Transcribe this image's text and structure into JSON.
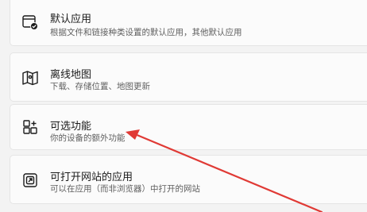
{
  "items": [
    {
      "title": "默认应用",
      "subtitle": "根据文件和链接种类设置的默认应用，其他默认应用",
      "icon": "default-apps-icon"
    },
    {
      "title": "离线地图",
      "subtitle": "下载、存储位置、地图更新",
      "icon": "map-icon"
    },
    {
      "title": "可选功能",
      "subtitle": "你的设备的额外功能",
      "icon": "optional-features-icon"
    },
    {
      "title": "可打开网站的应用",
      "subtitle": "可以在应用（而非浏览器）中打开的网站",
      "icon": "open-website-icon"
    }
  ],
  "annotation": {
    "type": "arrow",
    "color": "#e03a35",
    "points_to": "可选功能"
  }
}
